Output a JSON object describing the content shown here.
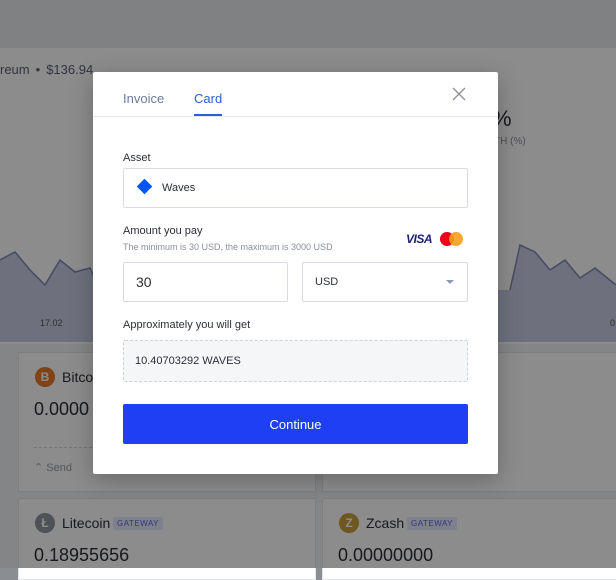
{
  "background": {
    "asset_prefix": "reum",
    "asset_price": "$136.94",
    "percent_symbol": "%",
    "percent_label": "TH (%)",
    "x_ticks": [
      "17.02",
      "0"
    ],
    "cards": [
      {
        "name": "Bitcoin",
        "balance": "0.0000",
        "action": "Send",
        "icon_letter": "B",
        "color": "#e9792b"
      },
      {
        "name": "Litecoin",
        "balance": "0.18955656",
        "badge": "GATEWAY",
        "icon_letter": "Ł",
        "color": "#8f949c"
      },
      {
        "name": "Zcash",
        "balance": "0.00000000",
        "badge": "GATEWAY",
        "icon_letter": "Z",
        "color": "#c9a03a"
      }
    ]
  },
  "modal": {
    "tabs": [
      {
        "label": "Invoice",
        "active": false
      },
      {
        "label": "Card",
        "active": true
      }
    ],
    "asset": {
      "label": "Asset",
      "value": "Waves",
      "icon_color": "#0055ff"
    },
    "amount": {
      "label": "Amount you pay",
      "hint": "The minimum is 30 USD,  the maximum is 3000 USD",
      "value": "30",
      "currency": "USD",
      "payment_brands": {
        "visa": "VISA",
        "mastercard": "mastercard-icon"
      }
    },
    "result": {
      "label": "Approximately you will get",
      "value": "10.40703292 WAVES"
    },
    "continue_label": "Continue"
  },
  "colors": {
    "accent": "#2f5bd8",
    "primary_button": "#1f3ff5"
  }
}
